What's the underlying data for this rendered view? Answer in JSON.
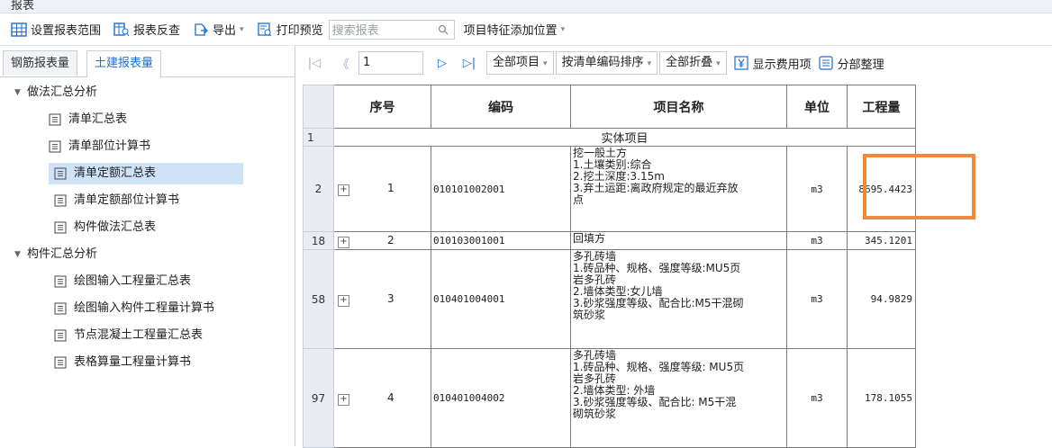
{
  "window": {
    "title": "报表"
  },
  "toolbar": {
    "set_range": "设置报表范围",
    "report_query": "报表反查",
    "export": "导出",
    "print_preview": "打印预览",
    "search_placeholder": "搜索报表",
    "feature_position": "项目特征添加位置"
  },
  "left_tabs": [
    "钢筋报表量",
    "土建报表量"
  ],
  "tree": {
    "group1": "做法汇总分析",
    "group1_items": [
      "清单汇总表",
      "清单部位计算书",
      "清单定额汇总表",
      "清单定额部位计算书",
      "构件做法汇总表"
    ],
    "group2": "构件汇总分析",
    "group2_items": [
      "绘图输入工程量汇总表",
      "绘图输入构件工程量计算书",
      "节点混凝土工程量汇总表",
      "表格算量工程量计算书"
    ],
    "selected": "清单定额汇总表"
  },
  "nav": {
    "page": "1",
    "all_items": "全部项目",
    "sort": "按清单编码排序",
    "fold": "全部折叠",
    "show_fee": "显示费用项",
    "section_arrange": "分部整理"
  },
  "table": {
    "headers": [
      "序号",
      "编码",
      "项目名称",
      "单位",
      "工程量"
    ],
    "section_title": "实体项目",
    "section_rownum": "1",
    "rows": [
      {
        "rownum": "2",
        "seq": "1",
        "code": "010101002001",
        "name_lines": [
          "挖一般土方",
          "1.土壤类别:综合",
          "2.挖土深度:3.15m",
          "3.弃土运距:离政府规定的最近弃放",
          "点"
        ],
        "unit": "m3",
        "qty": "8695.4423"
      },
      {
        "rownum": "18",
        "seq": "2",
        "code": "010103001001",
        "name_lines": [
          "回填方"
        ],
        "unit": "m3",
        "qty": "345.1201"
      },
      {
        "rownum": "58",
        "seq": "3",
        "code": "010401004001",
        "name_lines": [
          "多孔砖墙",
          "1.砖品种、规格、强度等级:MU5页",
          "岩多孔砖",
          "2.墙体类型:女儿墙",
          "3.砂浆强度等级、配合比:M5干混砌",
          "筑砂浆"
        ],
        "unit": "m3",
        "qty": "94.9829"
      },
      {
        "rownum": "97",
        "seq": "4",
        "code": "010401004002",
        "name_lines": [
          "多孔砖墙",
          "1.砖品种、规格、强度等级: MU5页",
          "岩多孔砖",
          "2.墙体类型: 外墙",
          "3.砂浆强度等级、配合比: M5干混",
          "砌筑砂浆"
        ],
        "unit": "m3",
        "qty": "178.1055"
      }
    ]
  }
}
